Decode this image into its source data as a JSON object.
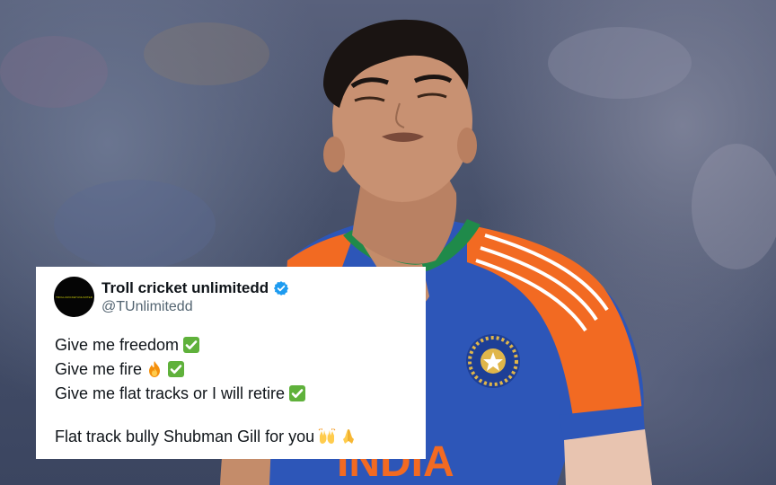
{
  "photo": {
    "jersey_text": "INDIA"
  },
  "tweet": {
    "avatar_text": "TROLLCRICKETUNLIMITED",
    "display_name": "Troll cricket unlimitedd",
    "handle": "@TUnlimitedd",
    "lines": [
      {
        "text": "Give me freedom",
        "emojis": [
          "check-mark-emoji"
        ]
      },
      {
        "text": "Give me fire",
        "emojis": [
          "fire-emoji",
          "check-mark-emoji"
        ]
      },
      {
        "text": "Give me flat tracks or I will retire",
        "emojis": [
          "check-mark-emoji"
        ]
      },
      {
        "text": "Flat track bully Shubman Gill for you",
        "emojis": [
          "raising-hands-emoji",
          "folded-hands-emoji"
        ]
      }
    ]
  },
  "colors": {
    "verified_badge": "#1d9bf0",
    "check_emoji": "#5fb13b",
    "jersey_blue": "#2d56b8",
    "jersey_orange": "#f26a22"
  }
}
